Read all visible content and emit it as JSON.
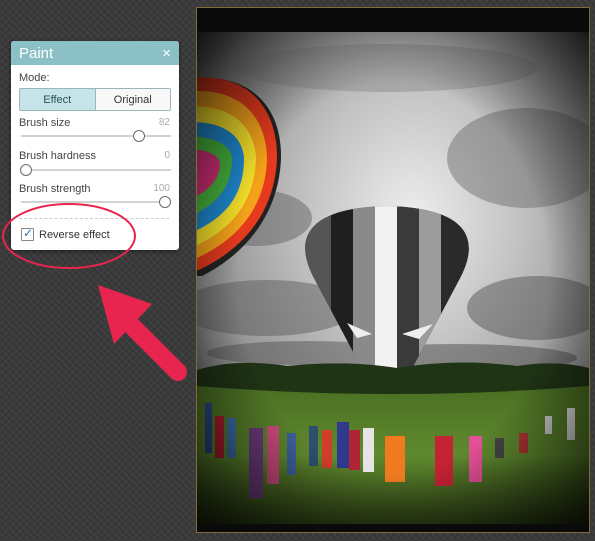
{
  "panel": {
    "title": "Paint",
    "close": "×",
    "mode_label": "Mode:",
    "modes": [
      "Effect",
      "Original"
    ],
    "active_mode": "Effect",
    "brush_size": {
      "label": "Brush size",
      "value": "82"
    },
    "brush_hardness": {
      "label": "Brush hardness",
      "value": "0"
    },
    "brush_strength": {
      "label": "Brush strength",
      "value": "100"
    },
    "reverse_effect": {
      "label": "Reverse effect",
      "checked": true
    }
  },
  "colors": {
    "header": "#8cc0c7",
    "active_mode": "#c5e4ea",
    "annotation_red": "#e8254e"
  }
}
